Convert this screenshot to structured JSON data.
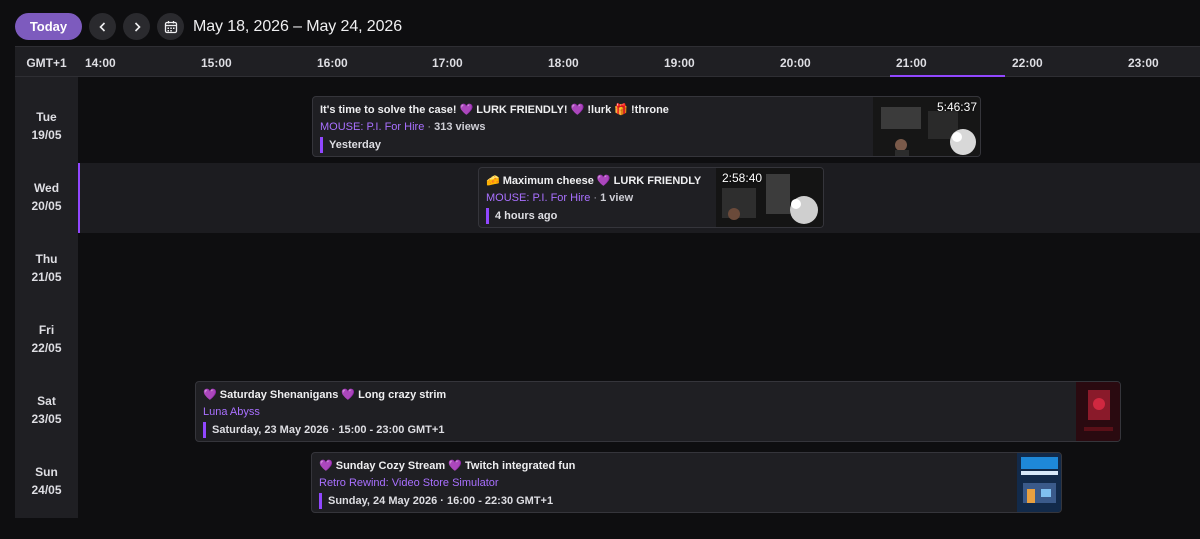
{
  "toolbar": {
    "today_label": "Today",
    "date_range": "May 18, 2026 – May 24, 2026"
  },
  "header": {
    "timezone": "GMT+1",
    "hours": [
      "14:00",
      "15:00",
      "16:00",
      "17:00",
      "18:00",
      "19:00",
      "20:00",
      "21:00",
      "22:00",
      "23:00"
    ],
    "current_hour": "21:00"
  },
  "days": [
    {
      "weekday": "Tue",
      "date": "19/05"
    },
    {
      "weekday": "Wed",
      "date": "20/05"
    },
    {
      "weekday": "Thu",
      "date": "21/05"
    },
    {
      "weekday": "Fri",
      "date": "22/05"
    },
    {
      "weekday": "Sat",
      "date": "23/05"
    },
    {
      "weekday": "Sun",
      "date": "24/05"
    }
  ],
  "events": [
    {
      "title": "It's time to solve the case! 💜 LURK FRIENDLY! 💜 !lurk 🎁 !throne",
      "game": "MOUSE: P.I. For Hire",
      "meta": "313 views",
      "time": "Yesterday",
      "duration": "5:46:37"
    },
    {
      "title": "🧀 Maximum cheese 💜 LURK FRIENDLY",
      "game": "MOUSE: P.I. For Hire",
      "meta": "1 view",
      "time": "4 hours ago",
      "duration": "2:58:40"
    },
    {
      "title": "💜 Saturday Shenanigans 💜 Long crazy strim",
      "game": "Luna Abyss",
      "meta": "",
      "time": "Saturday, 23 May 2026 · 15:00 - 23:00 GMT+1"
    },
    {
      "title": "💜 Sunday Cozy Stream 💜 Twitch integrated fun",
      "game": "Retro Rewind: Video Store Simulator",
      "meta": "",
      "time": "Sunday, 24 May 2026 · 16:00 - 22:30 GMT+1"
    }
  ],
  "colors": {
    "accent": "#9147ff",
    "today_button": "#7d5bbe",
    "game_link": "#a970ff",
    "background": "#0e0e10",
    "panel": "#1f1f23"
  }
}
